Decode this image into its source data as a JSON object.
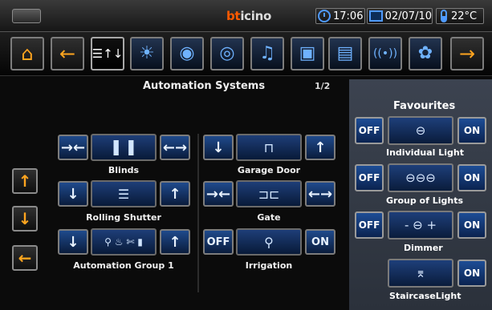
{
  "statusbar": {
    "brand_prefix": "bt",
    "brand_rest": "icino",
    "time": "17:06",
    "date": "02/07/10",
    "temperature": "22°C"
  },
  "nav": {
    "items": [
      {
        "name": "home-icon",
        "glyph": "⌂"
      },
      {
        "name": "back-arrow-icon",
        "glyph": "←"
      },
      {
        "name": "automation-icon",
        "glyph": "☰↑↓"
      },
      {
        "name": "lighting-icon",
        "glyph": "☀"
      },
      {
        "name": "scenarios-icon",
        "glyph": "◉"
      },
      {
        "name": "audio-icon",
        "glyph": "◎"
      },
      {
        "name": "multimedia-icon",
        "glyph": "♫"
      },
      {
        "name": "video-icon",
        "glyph": "▣"
      },
      {
        "name": "intercom-icon",
        "glyph": "▤"
      },
      {
        "name": "wireless-icon",
        "glyph": "((•))"
      },
      {
        "name": "thermometer-icon",
        "glyph": "🌡"
      },
      {
        "name": "settings-icon",
        "glyph": "✿"
      },
      {
        "name": "forward-arrow-icon",
        "glyph": "→"
      }
    ]
  },
  "main": {
    "title": "Automation Systems",
    "page": "1/2"
  },
  "side": {
    "up": "↑",
    "down": "↓",
    "back": "←"
  },
  "controls": {
    "blinds": {
      "label": "Blinds",
      "left": "→←",
      "image": "▌▐",
      "right": "←→"
    },
    "rolling": {
      "label": "Rolling Shutter",
      "left": "↓",
      "image": "☰",
      "right": "↑"
    },
    "group": {
      "label": "Automation Group 1",
      "left": "↓",
      "image": "⚲ ♨ ✄ ▮",
      "right": "↑"
    },
    "garage": {
      "label": "Garage Door",
      "left": "↓",
      "image": "⊓",
      "right": "↑"
    },
    "gate": {
      "label": "Gate",
      "left": "→←",
      "image": "⊐⊏",
      "right": "←→"
    },
    "irrigation": {
      "label": "Irrigation",
      "left": "OFF",
      "image": "⚲",
      "right": "ON"
    }
  },
  "favourites": {
    "title": "Favourites",
    "items": [
      {
        "label": "Individual Light",
        "off": "OFF",
        "on": "ON",
        "image": "⊖"
      },
      {
        "label": "Group of Lights",
        "off": "OFF",
        "on": "ON",
        "image": "⊖⊖⊖"
      },
      {
        "label": "Dimmer",
        "off": "OFF",
        "on": "ON",
        "image": "- ⊖ +"
      },
      {
        "label": "StaircaseLight",
        "on": "ON",
        "image": "⌆"
      }
    ]
  }
}
